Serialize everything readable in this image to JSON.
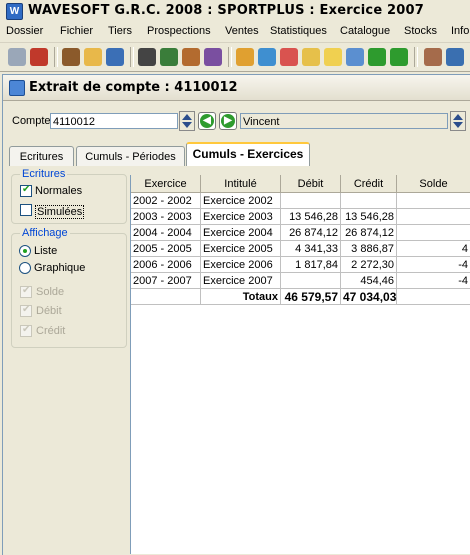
{
  "app": {
    "title": "WAVESOFT G.R.C. 2008 : SPORTPLUS : Exercice 2007"
  },
  "menu": [
    "Dossier",
    "Fichier",
    "Tiers",
    "Prospections",
    "Ventes",
    "Statistiques",
    "Catalogue",
    "Stocks",
    "Info"
  ],
  "window": {
    "title": "Extrait de compte : 4110012"
  },
  "compte": {
    "label": "Compte",
    "value": "4110012",
    "name": "Vincent"
  },
  "tabs": [
    "Ecritures",
    "Cumuls - Périodes",
    "Cumuls - Exercices"
  ],
  "ecritures_group": {
    "title": "Ecritures",
    "normales": "Normales",
    "simulees": "Simulées"
  },
  "affichage_group": {
    "title": "Affichage",
    "liste": "Liste",
    "graphique": "Graphique",
    "solde": "Solde",
    "debit": "Débit",
    "credit": "Crédit"
  },
  "table": {
    "headers": [
      "Exercice",
      "Intitulé",
      "Débit",
      "Crédit",
      "Solde"
    ],
    "rows": [
      [
        "2002 - 2002",
        "Exercice 2002",
        "",
        "",
        ""
      ],
      [
        "2003 - 2003",
        "Exercice 2003",
        "13 546,28",
        "13 546,28",
        ""
      ],
      [
        "2004 - 2004",
        "Exercice 2004",
        "26 874,12",
        "26 874,12",
        ""
      ],
      [
        "2005 - 2005",
        "Exercice 2005",
        "4 341,33",
        "3 886,87",
        "4"
      ],
      [
        "2006 - 2006",
        "Exercice 2006",
        "1 817,84",
        "2 272,30",
        "-4"
      ],
      [
        "2007 - 2007",
        "Exercice 2007",
        "",
        "454,46",
        "-4"
      ]
    ],
    "totals_label": "Totaux",
    "total_debit": "46 579,57",
    "total_credit": "47 034,03"
  },
  "colors": {
    "accent_tab": "#ffc83c",
    "group_label": "#0046d5",
    "nav_button": "#2e9b2e"
  }
}
